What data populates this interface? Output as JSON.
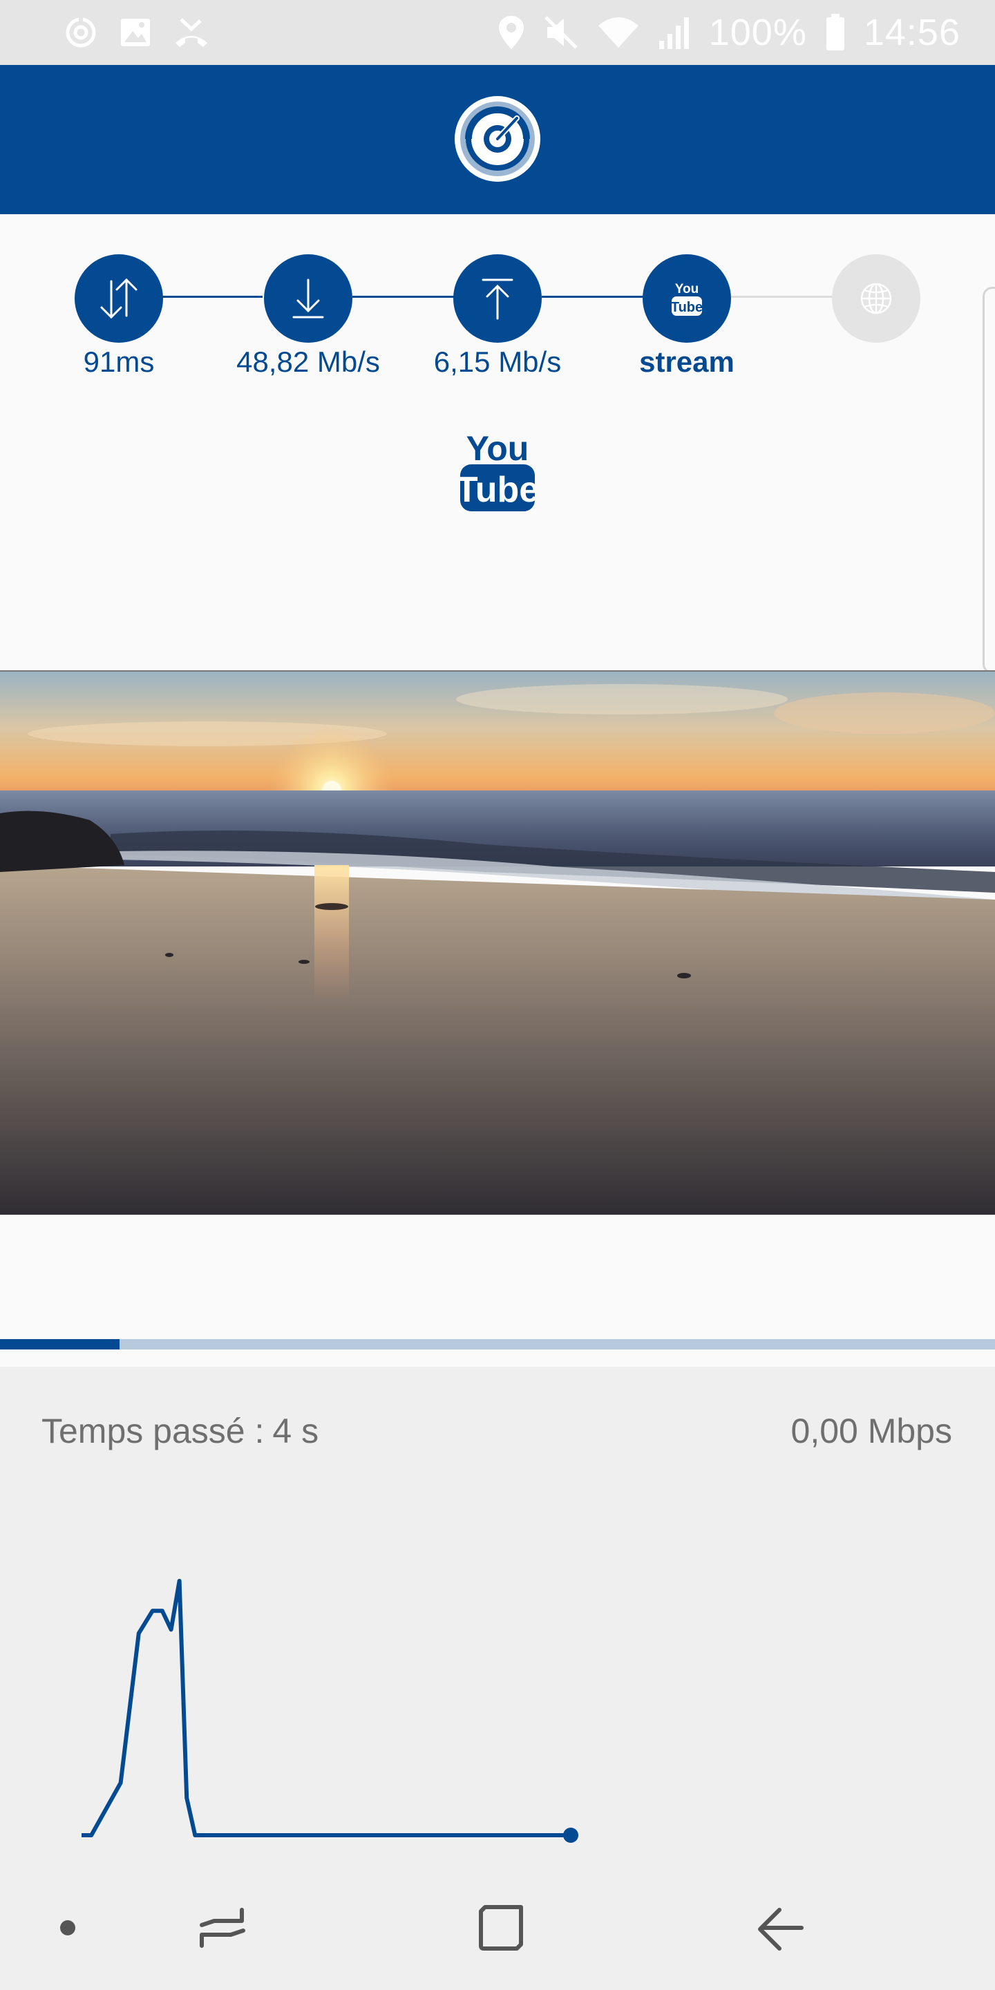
{
  "status_bar": {
    "battery": "100%",
    "time": "14:56",
    "icons": [
      "data-saver-icon",
      "gallery-icon",
      "missed-call-icon",
      "location-icon",
      "mute-icon",
      "wifi-icon",
      "signal-icon",
      "battery-icon"
    ]
  },
  "app_bar": {
    "logo": "speedometer-logo-icon"
  },
  "steps": [
    {
      "icon": "ping-arrows-icon",
      "label": "91ms",
      "state": "done"
    },
    {
      "icon": "download-icon",
      "label": "48,82 Mb/s",
      "state": "done"
    },
    {
      "icon": "upload-icon",
      "label": "6,15 Mb/s",
      "state": "done"
    },
    {
      "icon": "youtube-icon",
      "label": "stream",
      "state": "current"
    },
    {
      "icon": "globe-icon",
      "label": "",
      "state": "pending"
    }
  ],
  "stream_service": {
    "icon": "youtube-logo-icon",
    "text_top": "You",
    "text_bottom": "Tube"
  },
  "video": {
    "description_icon": "sunset-beach-video"
  },
  "progress": {
    "fraction": 0.12
  },
  "stats": {
    "elapsed_label": "Temps passé :",
    "elapsed_value": "4 s",
    "speed_value": "0,00 Mbps"
  },
  "graph": {
    "type": "line",
    "values": [
      0,
      0,
      14,
      54,
      60,
      60,
      55,
      68,
      10,
      0,
      0,
      0,
      0,
      0,
      0,
      0,
      0,
      0,
      0
    ],
    "color": "#034a92"
  },
  "nav_bar": {
    "buttons": [
      "assistant-dot-icon",
      "recents-icon",
      "home-icon",
      "back-icon"
    ]
  },
  "colors": {
    "brand": "#034a92",
    "inactive": "#e4e4e4",
    "progress_track": "#b7c9dc"
  }
}
